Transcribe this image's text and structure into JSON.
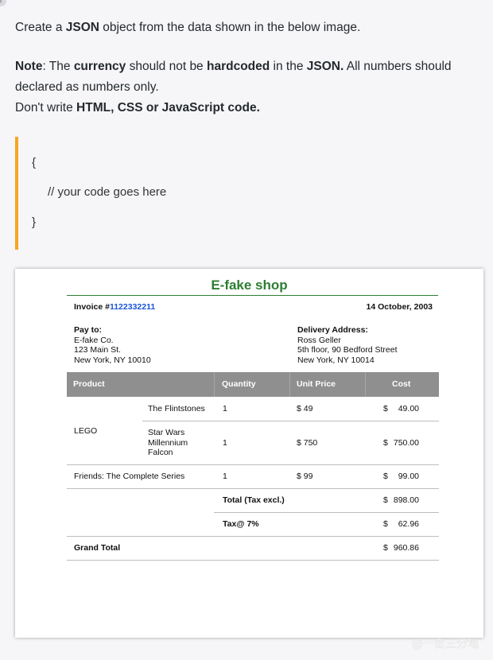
{
  "prompt": {
    "line1_pre": "Create a ",
    "line1_bold": "JSON",
    "line1_post": " object from the data shown in the below image.",
    "note_bold": "Note",
    "note_t1": ": The ",
    "note_b1": "currency",
    "note_t2": " should not be ",
    "note_b2": "hardcoded",
    "note_t3": " in the ",
    "note_b3": "JSON.",
    "note_t4": " All numbers should declared as numbers only.",
    "line3_pre": "Don't write ",
    "line3_bold": "HTML, CSS or JavaScript code."
  },
  "code": {
    "open_brace": "{",
    "comment": "// your code goes here",
    "close_brace": "}"
  },
  "invoice": {
    "shop_name": "E-fake shop",
    "invoice_label": "Invoice #",
    "invoice_number": "1122332211",
    "date": "14 October, 2003",
    "pay_to": {
      "header": "Pay to:",
      "lines": [
        "E-fake Co.",
        "123 Main St.",
        "New York, NY 10010"
      ]
    },
    "delivery": {
      "header": "Delivery Address:",
      "lines": [
        "Ross Geller",
        "5th floor, 90 Bedford Street",
        "New York, NY 10014"
      ]
    },
    "columns": [
      "Product",
      "Quantity",
      "Unit Price",
      "Cost"
    ],
    "rows": {
      "lego_group": "LEGO",
      "flintstones": {
        "name": "The Flintstones",
        "qty": "1",
        "unit": "$ 49",
        "cost_sym": "$",
        "cost": "49.00"
      },
      "starwars": {
        "name_lines": [
          "Star Wars",
          "Millennium",
          "Falcon"
        ],
        "qty": "1",
        "unit": "$ 750",
        "cost_sym": "$",
        "cost": "750.00"
      },
      "friends": {
        "name": "Friends: The Complete Series",
        "qty": "1",
        "unit": "$ 99",
        "cost_sym": "$",
        "cost": "99.00"
      }
    },
    "total_label": "Total (Tax excl.)",
    "total_sym": "$",
    "total": "898.00",
    "tax_label": "Tax@ 7%",
    "tax_sym": "$",
    "tax": "62.96",
    "grand_label": "Grand Total",
    "grand_sym": "$",
    "grand": "960.86"
  },
  "watermark": {
    "text": "@一亩三分地"
  }
}
